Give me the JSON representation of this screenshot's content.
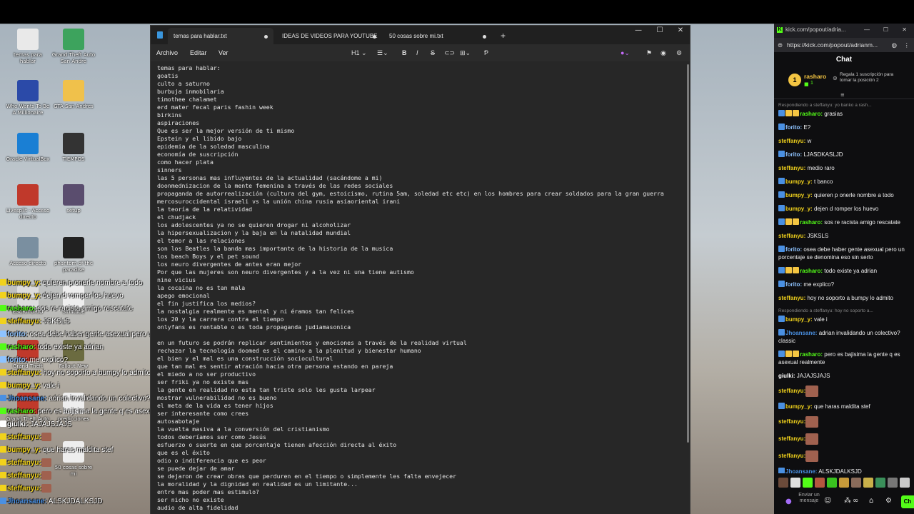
{
  "desktop": {
    "icons": [
      {
        "label": "temas para hablar"
      },
      {
        "label": "Grand Theft Auto San Andre"
      },
      {
        "label": "Who Wants To Be A Millionaire"
      },
      {
        "label": "GTA San Andres"
      },
      {
        "label": "Oracle VirtualBox"
      },
      {
        "label": "TIEMPOS"
      },
      {
        "label": "Livesplit - Acceso directo"
      },
      {
        "label": "setup"
      },
      {
        "label": "Acceso directo"
      },
      {
        "label": "phantom of the paradise"
      },
      {
        "label": "ESCRITORIO"
      },
      {
        "label": "Simitube"
      },
      {
        "label": "Grand Theft"
      },
      {
        "label": "Fallout New"
      },
      {
        "label": "Grand Theft Auto"
      },
      {
        "label": "predicciones"
      },
      {
        "label": "50 cosas sobre mi"
      }
    ]
  },
  "overlay_chat": [
    {
      "user": "bumpy_y:",
      "text": " quieren p onerle nombre a todo",
      "color": "#f1d21c"
    },
    {
      "user": "bumpy_y:",
      "text": " dejen d romper los huevo",
      "color": "#f1d21c"
    },
    {
      "user": "rasharo:",
      "text": " sos re racista amigo rescatate",
      "color": "#53fc18"
    },
    {
      "user": "steffanyu:",
      "text": " JSKSLS",
      "color": "#f1d21c"
    },
    {
      "user": "forito:",
      "text": " osea debe haber gente asexual pero un porcentaje se denomina eso sin serlo",
      "color": "#8ec3ff"
    },
    {
      "user": "rasharo:",
      "text": " todo existe ya adrian",
      "color": "#53fc18"
    },
    {
      "user": "forito:",
      "text": " me explico?",
      "color": "#8ec3ff"
    },
    {
      "user": "steffanyu:",
      "text": " hoy no soporto a bumpy lo admito",
      "color": "#f1d21c"
    },
    {
      "user": "bumpy_y:",
      "text": " vale i",
      "color": "#f1d21c"
    },
    {
      "user": "Jhoansane:",
      "text": " adrian invalidando un colectivo? classic",
      "color": "#4a90e2"
    },
    {
      "user": "rasharo:",
      "text": " pero es bajisima la gente q es asexual realmente",
      "color": "#53fc18"
    },
    {
      "user": "giulki:",
      "text": " JAJAJSJAJS",
      "color": "#ffffff"
    },
    {
      "user": "steffanyu:",
      "text": "",
      "color": "#f1d21c"
    },
    {
      "user": "bumpy_y:",
      "text": " que haras maldita stef",
      "color": "#f1d21c"
    },
    {
      "user": "steffanyu:",
      "text": "",
      "color": "#f1d21c"
    },
    {
      "user": "steffanyu:",
      "text": "",
      "color": "#f1d21c"
    },
    {
      "user": "steffanyu:",
      "text": "",
      "color": "#f1d21c"
    },
    {
      "user": "Jhoansane:",
      "text": " ALSKJDALKSJD",
      "color": "#4a90e2"
    }
  ],
  "notepad": {
    "tabs": [
      {
        "label": "temas para hablar.txt",
        "active": true
      },
      {
        "label": "IDEAS DE VIDEOS PARA YOUTUBE",
        "active": false
      },
      {
        "label": "50 cosas sobre mi.txt",
        "active": false
      }
    ],
    "new_tab": "+",
    "menu": {
      "archivo": "Archivo",
      "editar": "Editar",
      "ver": "Ver"
    },
    "toolbar": {
      "heading": "H1"
    },
    "lines": [
      "temas para hablar:",
      "goatis",
      "culto a saturno",
      "burbuja inmobilaria",
      "timothee chalamet",
      "erd mater fecal paris fashin week",
      "birkins",
      "aspiraciones",
      "Que es ser la mejor versión de ti mismo",
      "Epstein y el libido bajo",
      "epidemia de la soledad masculina",
      "economía de suscripción",
      "como hacer plata",
      "sinners",
      "las 5 personas mas influyentes de la actualidad (sacándome a mi)",
      "doonmednizacion de la mente femenina a través de las redes sociales",
      "propaganda de autorrealización (cultura del gym, estoicismo, rutina 5am, soledad etc etc) en los hombres para crear soldados para la gran guerra",
      "mercosuroccidental israeli vs la unión china rusia asiaoriental irani",
      "la teoría de la relatividad",
      "el chudjack",
      "los adolescentes ya no se quieren drogar ni alcoholizar",
      "la hipersexualizacion y la baja en la natalidad mundial",
      "el temor a las relaciones",
      "son los Beatles la banda mas importante de la historia de la musica",
      "los beach Boys y el pet sound",
      "los neuro divergentes de antes eran mejor",
      "Por que las mujeres son neuro divergentes y a la vez ni una tiene autismo",
      "nine vicius",
      "la cocaína no es tan mala",
      "apego emocional",
      "el fin justifica los medios?",
      "la nostalgia realmente es mental y ni éramos tan felices",
      "los 20 y la carrera contra el tiempo",
      "onlyfans es rentable o es toda propaganda judiamasonica",
      "",
      "en un futuro se podrán replicar sentimientos y emociones a través de la realidad virtual",
      "rechazar la tecnología doomed es el camino a la plenitud y bienestar humano",
      "el bien y el mal es una construcción sociocultural",
      "que tan mal es sentir atración hacia otra persona estando en pareja",
      "el miedo a no ser productivo",
      "ser friki ya no existe mas",
      "la gente en realidad no esta tan triste solo les gusta larpear",
      "mostrar vulnerabilidad no es bueno",
      "el meta de la vida es tener hijos",
      "ser interesante como crees",
      "autosabotaje",
      "la vuelta masiva a la conversión del cristianismo",
      "todos deberíamos ser como Jesús",
      "esfuerzo o suerte en que porcentaje tienen afección directa al éxito",
      "que es el éxito",
      "odio o indiferencia que es peor",
      "se puede dejar de amar",
      "se dejaron de crear obras que perduren en el tiempo o simplemente les falta envejecer",
      "la moralidad y la dignidad en realidad es un limitante...",
      "entre mas poder mas estimulo?",
      "ser nicho no existe",
      "audio de alta fidelidad"
    ]
  },
  "browser": {
    "tab_title": "kick.com/popout/adria...",
    "url": "https://kick.com/popout/adrianm...",
    "chat_title": "Chat",
    "pinned": {
      "rank": "1",
      "user": "rasharo",
      "count": "1",
      "gift_text": "Regala 1 suscripción para tomar la posición 2"
    },
    "messages": [
      {
        "reply": "Respondiendo a steffanyu: yo banko a rash...",
        "user": "",
        "text": "",
        "color": "#fff"
      },
      {
        "reply": "",
        "user": "rasharo:",
        "text": " grasias",
        "color": "#53fc18"
      },
      {
        "reply": "",
        "user": "forito:",
        "text": " E?",
        "color": "#8ec3ff"
      },
      {
        "reply": "",
        "user": "steffanyu:",
        "text": " w",
        "color": "#f1d21c"
      },
      {
        "reply": "",
        "user": "forito:",
        "text": " LJASDKASLJD",
        "color": "#8ec3ff"
      },
      {
        "reply": "",
        "user": "steffanyu:",
        "text": " medio raro",
        "color": "#f1d21c"
      },
      {
        "reply": "",
        "user": "bumpy_y:",
        "text": " t banco",
        "color": "#f1d21c"
      },
      {
        "reply": "",
        "user": "bumpy_y:",
        "text": " quieren p onerle nombre a todo",
        "color": "#f1d21c"
      },
      {
        "reply": "",
        "user": "bumpy_y:",
        "text": " dejen d romper los huevo",
        "color": "#f1d21c"
      },
      {
        "reply": "",
        "user": "rasharo:",
        "text": " sos re racista amigo rescatate",
        "color": "#53fc18"
      },
      {
        "reply": "",
        "user": "steffanyu:",
        "text": " JSKSLS",
        "color": "#f1d21c"
      },
      {
        "reply": "",
        "user": "forito:",
        "text": " osea debe haber gente asexual pero un porcentaje se denomina eso sin serlo",
        "color": "#8ec3ff"
      },
      {
        "reply": "",
        "user": "rasharo:",
        "text": " todo existe ya adrian",
        "color": "#53fc18"
      },
      {
        "reply": "",
        "user": "forito:",
        "text": " me explico?",
        "color": "#8ec3ff"
      },
      {
        "reply": "",
        "user": "steffanyu:",
        "text": " hoy no soporto a bumpy lo admito",
        "color": "#f1d21c"
      },
      {
        "reply": "Respondiendo a steffanyu: hoy no soporto a...",
        "user": "",
        "text": "",
        "color": "#fff"
      },
      {
        "reply": "",
        "user": "bumpy_y:",
        "text": " vale i",
        "color": "#f1d21c"
      },
      {
        "reply": "",
        "user": "Jhoansane:",
        "text": " adrian invalidando un colectivo? classic",
        "color": "#4a90e2"
      },
      {
        "reply": "",
        "user": "rasharo:",
        "text": " pero es bajisima la gente q es asexual realmente",
        "color": "#53fc18"
      },
      {
        "reply": "",
        "user": "giulki:",
        "text": " JAJAJSJAJS",
        "color": "#ffffff"
      },
      {
        "reply": "",
        "user": "steffanyu:",
        "text": "",
        "color": "#f1d21c",
        "emote": true
      },
      {
        "reply": "",
        "user": "bumpy_y:",
        "text": " que haras maldita stef",
        "color": "#f1d21c"
      },
      {
        "reply": "",
        "user": "steffanyu:",
        "text": "",
        "color": "#f1d21c",
        "emote": true
      },
      {
        "reply": "",
        "user": "steffanyu:",
        "text": "",
        "color": "#f1d21c",
        "emote": true
      },
      {
        "reply": "",
        "user": "steffanyu:",
        "text": "",
        "color": "#f1d21c",
        "emote": true
      },
      {
        "reply": "",
        "user": "Jhoansane:",
        "text": " ALSKJDALKSJD",
        "color": "#4a90e2"
      }
    ],
    "input_placeholder": "Enviar un mensaje",
    "send_label": "Ch"
  },
  "colors": {
    "kick_green": "#53fc18",
    "editor_bg": "#272727",
    "chat_bg": "#0e0e10"
  }
}
